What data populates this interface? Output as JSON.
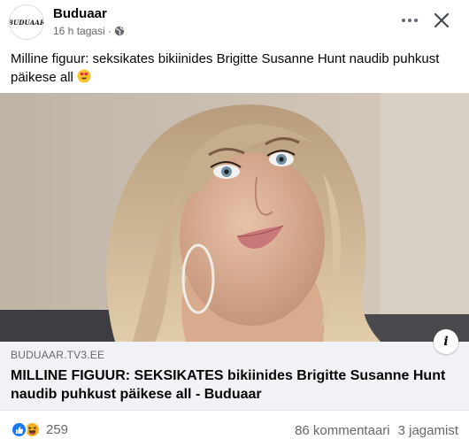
{
  "post": {
    "page_name": "Buduaar",
    "avatar_text": "BUDUAAR",
    "time": "16 h tagasi",
    "separator": "·",
    "text": "Milline figuur: seksikates bikiinides Brigitte Susanne Hunt naudib puhkust päikese all"
  },
  "link": {
    "domain": "BUDUAAR.TV3.EE",
    "title": "MILLINE FIGUUR: SEKSIKATES bikiinides Brigitte Susanne Hunt naudib puhkust päikese all - Buduaar",
    "info_label": "i"
  },
  "footer": {
    "reaction_count": "259",
    "comments": "86 kommentaari",
    "shares": "3 jagamist"
  },
  "icons": {
    "more": "more-options-icon",
    "close": "close-icon",
    "globe": "globe-icon",
    "emoji": "heart-eyes-emoji",
    "like": "like-reaction-icon",
    "haha": "haha-reaction-icon"
  },
  "colors": {
    "like_blue": "#1877f2",
    "haha_yellow": "#f7b125",
    "secondary_text": "#65676b",
    "card_bg": "#f0f2f5"
  }
}
